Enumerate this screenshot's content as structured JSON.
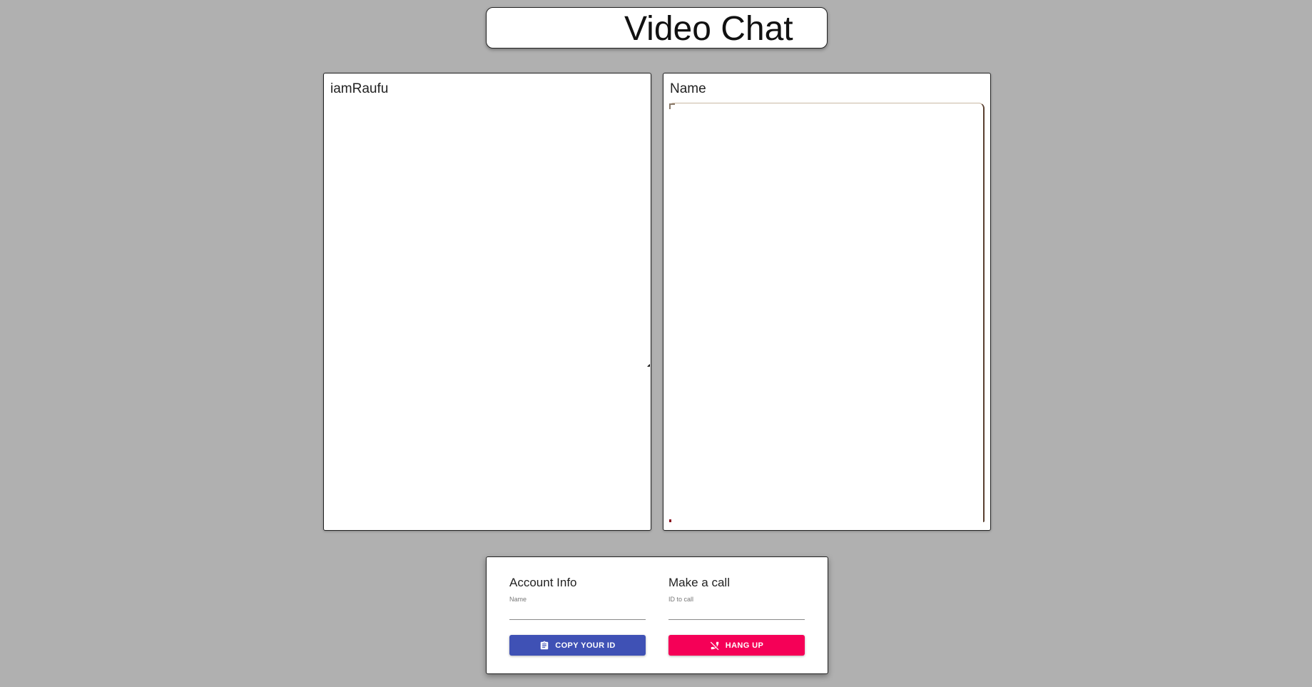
{
  "header": {
    "title": "Video Chat"
  },
  "videos": {
    "local": {
      "name": "iamRaufu"
    },
    "remote": {
      "name": "Name"
    }
  },
  "options": {
    "account": {
      "heading": "Account Info",
      "name_label": "Name",
      "name_value": ""
    },
    "call": {
      "heading": "Make a call",
      "id_label": "ID to call",
      "id_value": ""
    },
    "copy_button": {
      "label": "COPY YOUR ID",
      "icon": "clipboard-icon"
    },
    "hangup_button": {
      "label": "HANG UP",
      "icon": "phone-disabled-icon"
    }
  },
  "colors": {
    "background": "#b0b0b0",
    "copy_button": "#3f51b5",
    "hangup_button": "#f50057"
  }
}
